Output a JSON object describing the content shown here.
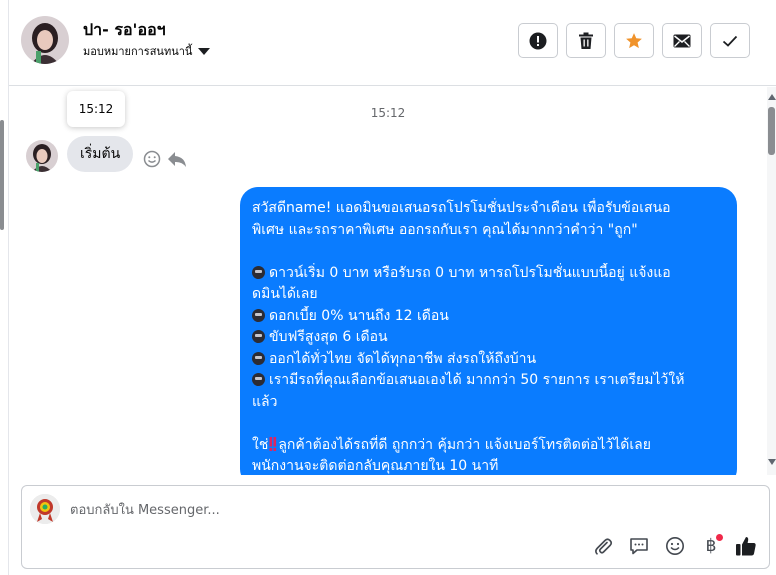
{
  "header": {
    "contact_name": "ปา- รอ'ออฯ",
    "assign_label": "มอบหมายการสนทนานี้",
    "actions": [
      {
        "name": "mark-spam-button",
        "icon": "exclamation-circle-icon"
      },
      {
        "name": "delete-button",
        "icon": "trash-icon"
      },
      {
        "name": "star-button",
        "icon": "star-icon",
        "color": "#f0932b"
      },
      {
        "name": "mark-unread-button",
        "icon": "envelope-icon"
      },
      {
        "name": "mark-done-button",
        "icon": "checkmark-icon"
      }
    ]
  },
  "thread": {
    "tooltip_time": "15:12",
    "time_separator": "15:12",
    "incoming_message": "เริ่มต้น",
    "outgoing_message_lines": [
      "สวัสดีname! แอดมินขอเสนอรถโปรโมชั่นประจำเดือน เพื่อรับข้อเสนอ",
      "พิเศษ และรถราคาพิเศษ ออกรถกับเรา คุณได้มากกว่าคำว่า \"ถูก\"",
      "",
      "ดาวน์เริ่ม 0 บาท หรือรับรถ 0 บาท หารถโปรโมชั่นแบบนี้อยู่ แจ้งแอ",
      "ดมินได้เลย",
      "ดอกเบี้ย 0% นานถึง 12 เดือน",
      "ขับฟรีสูงสุด 6 เดือน",
      "ออกได้ทั่วไทย จัดได้ทุกอาชีพ ส่งรถให้ถึงบ้าน",
      "เรามีรถที่คุณเลือกข้อเสนอเองได้ มากกว่า 50 รายการ เราเตรียมไว้ให้",
      "แล้ว",
      "",
      "ใช่",
      "ลูกค้าต้องได้รถที่ดี ถูกกว่า คุ้มกว่า แจ้งเบอร์โทรติดต่อไว้ได้เลย",
      "พนักงานจะติดต่อกลับคุณภายใน 10 นาที"
    ],
    "bubble_color": "#0a7cff"
  },
  "composer": {
    "placeholder": "ตอบกลับใน Messenger...",
    "baht_symbol": "฿",
    "tools": [
      "paperclip-icon",
      "saved-reply-icon",
      "emoji-icon",
      "baht-payment-icon",
      "thumbs-up-icon"
    ]
  }
}
